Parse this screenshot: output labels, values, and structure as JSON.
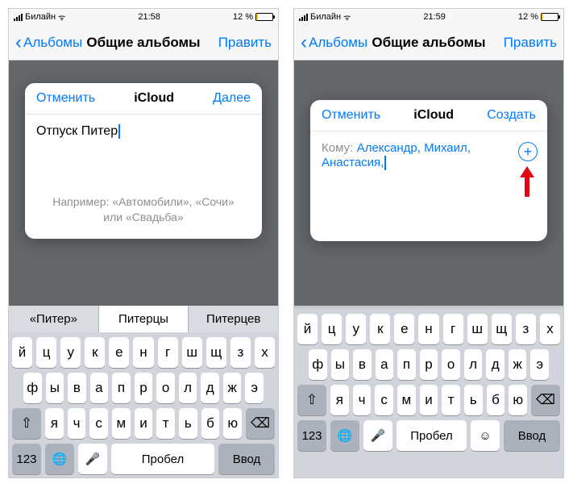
{
  "left": {
    "status": {
      "carrier": "Билайн",
      "time": "21:58",
      "battery_pct": "12 %"
    },
    "nav": {
      "back": "Альбомы",
      "title": "Общие альбомы",
      "edit": "Править"
    },
    "modal": {
      "cancel": "Отменить",
      "title": "iCloud",
      "next": "Далее",
      "input": "Отпуск Питер",
      "hint": "Например: «Автомобили», «Сочи» или «Свадьба»"
    },
    "suggestions": [
      "«Питер»",
      "Питерцы",
      "Питерцев"
    ],
    "keyboard": {
      "row1": [
        "й",
        "ц",
        "у",
        "к",
        "е",
        "н",
        "г",
        "ш",
        "щ",
        "з",
        "х"
      ],
      "row2": [
        "ф",
        "ы",
        "в",
        "а",
        "п",
        "р",
        "о",
        "л",
        "д",
        "ж",
        "э"
      ],
      "row3": [
        "я",
        "ч",
        "с",
        "м",
        "и",
        "т",
        "ь",
        "б",
        "ю"
      ],
      "shift": "⇧",
      "del": "⌫",
      "k123": "123",
      "globe": "🌐",
      "mic": "🎤",
      "space": "Пробел",
      "enter": "Ввод"
    }
  },
  "right": {
    "status": {
      "carrier": "Билайн",
      "time": "21:59",
      "battery_pct": "12 %"
    },
    "nav": {
      "back": "Альбомы",
      "title": "Общие альбомы",
      "edit": "Править"
    },
    "modal": {
      "cancel": "Отменить",
      "title": "iCloud",
      "create": "Создать",
      "to_label": "Кому:",
      "to_names": "Александр, Михаил, Анастасия,",
      "add": "+"
    },
    "keyboard": {
      "row1": [
        "й",
        "ц",
        "у",
        "к",
        "е",
        "н",
        "г",
        "ш",
        "щ",
        "з",
        "х"
      ],
      "row2": [
        "ф",
        "ы",
        "в",
        "а",
        "п",
        "р",
        "о",
        "л",
        "д",
        "ж",
        "э"
      ],
      "row3": [
        "я",
        "ч",
        "с",
        "м",
        "и",
        "т",
        "ь",
        "б",
        "ю"
      ],
      "shift": "⇧",
      "del": "⌫",
      "k123": "123",
      "globe": "🌐",
      "mic": "🎤",
      "space": "Пробел",
      "emoji": "☺",
      "enter": "Ввод"
    }
  },
  "icons": {
    "wifi": "ᯤ"
  }
}
